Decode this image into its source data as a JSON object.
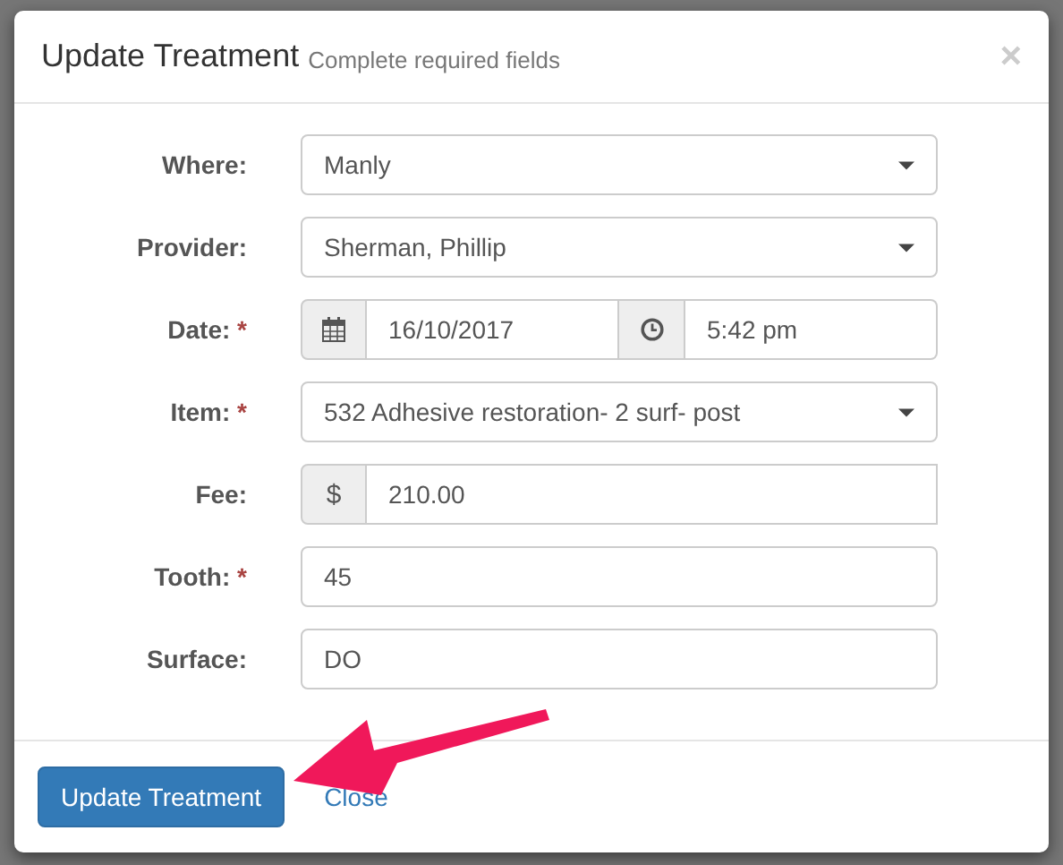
{
  "modal": {
    "title": "Update Treatment",
    "subtitle": "Complete required fields",
    "close": "×"
  },
  "fields": [
    {
      "kind": "select",
      "label": "Where:",
      "value": "Manly"
    },
    {
      "kind": "select",
      "label": "Provider:",
      "value": "Sherman, Phillip"
    },
    {
      "kind": "datetime",
      "label": "Date:",
      "required_mark": "*",
      "value": "16/10/2017",
      "time": "5:42 pm"
    },
    {
      "kind": "select",
      "label": "Item:",
      "required_mark": "*",
      "value": "532 Adhesive restoration- 2 surf- post"
    },
    {
      "kind": "addon",
      "label": "Fee:",
      "addon": "$",
      "value": "210.00"
    },
    {
      "kind": "text",
      "label": "Tooth:",
      "required_mark": "*",
      "value": "45"
    },
    {
      "kind": "text",
      "label": "Surface:",
      "value": "DO"
    }
  ],
  "footer": {
    "primary": "Update Treatment",
    "link": "Close"
  },
  "annotation": {
    "kind": "arrow",
    "color": "#f0185a"
  }
}
